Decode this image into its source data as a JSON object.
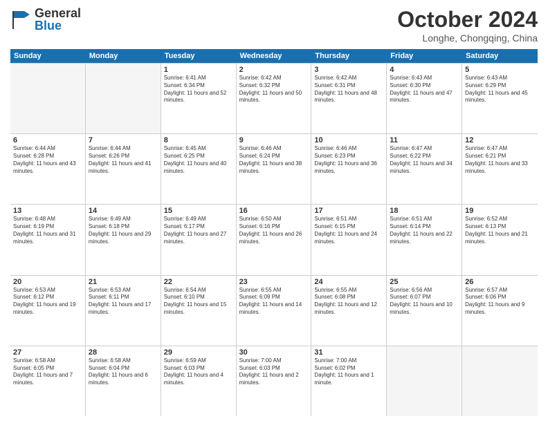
{
  "header": {
    "logo_general": "General",
    "logo_blue": "Blue",
    "month_title": "October 2024",
    "location": "Longhe, Chongqing, China"
  },
  "days_of_week": [
    "Sunday",
    "Monday",
    "Tuesday",
    "Wednesday",
    "Thursday",
    "Friday",
    "Saturday"
  ],
  "weeks": [
    [
      {
        "day": "",
        "info": "",
        "empty": true
      },
      {
        "day": "",
        "info": "",
        "empty": true
      },
      {
        "day": "1",
        "info": "Sunrise: 6:41 AM\nSunset: 6:34 PM\nDaylight: 11 hours and 52 minutes."
      },
      {
        "day": "2",
        "info": "Sunrise: 6:42 AM\nSunset: 6:32 PM\nDaylight: 11 hours and 50 minutes."
      },
      {
        "day": "3",
        "info": "Sunrise: 6:42 AM\nSunset: 6:31 PM\nDaylight: 11 hours and 48 minutes."
      },
      {
        "day": "4",
        "info": "Sunrise: 6:43 AM\nSunset: 6:30 PM\nDaylight: 11 hours and 47 minutes."
      },
      {
        "day": "5",
        "info": "Sunrise: 6:43 AM\nSunset: 6:29 PM\nDaylight: 11 hours and 45 minutes."
      }
    ],
    [
      {
        "day": "6",
        "info": "Sunrise: 6:44 AM\nSunset: 6:28 PM\nDaylight: 11 hours and 43 minutes."
      },
      {
        "day": "7",
        "info": "Sunrise: 6:44 AM\nSunset: 6:26 PM\nDaylight: 11 hours and 41 minutes."
      },
      {
        "day": "8",
        "info": "Sunrise: 6:45 AM\nSunset: 6:25 PM\nDaylight: 11 hours and 40 minutes."
      },
      {
        "day": "9",
        "info": "Sunrise: 6:46 AM\nSunset: 6:24 PM\nDaylight: 11 hours and 38 minutes."
      },
      {
        "day": "10",
        "info": "Sunrise: 6:46 AM\nSunset: 6:23 PM\nDaylight: 11 hours and 36 minutes."
      },
      {
        "day": "11",
        "info": "Sunrise: 6:47 AM\nSunset: 6:22 PM\nDaylight: 11 hours and 34 minutes."
      },
      {
        "day": "12",
        "info": "Sunrise: 6:47 AM\nSunset: 6:21 PM\nDaylight: 11 hours and 33 minutes."
      }
    ],
    [
      {
        "day": "13",
        "info": "Sunrise: 6:48 AM\nSunset: 6:19 PM\nDaylight: 11 hours and 31 minutes."
      },
      {
        "day": "14",
        "info": "Sunrise: 6:49 AM\nSunset: 6:18 PM\nDaylight: 11 hours and 29 minutes."
      },
      {
        "day": "15",
        "info": "Sunrise: 6:49 AM\nSunset: 6:17 PM\nDaylight: 11 hours and 27 minutes."
      },
      {
        "day": "16",
        "info": "Sunrise: 6:50 AM\nSunset: 6:16 PM\nDaylight: 11 hours and 26 minutes."
      },
      {
        "day": "17",
        "info": "Sunrise: 6:51 AM\nSunset: 6:15 PM\nDaylight: 11 hours and 24 minutes."
      },
      {
        "day": "18",
        "info": "Sunrise: 6:51 AM\nSunset: 6:14 PM\nDaylight: 11 hours and 22 minutes."
      },
      {
        "day": "19",
        "info": "Sunrise: 6:52 AM\nSunset: 6:13 PM\nDaylight: 11 hours and 21 minutes."
      }
    ],
    [
      {
        "day": "20",
        "info": "Sunrise: 6:53 AM\nSunset: 6:12 PM\nDaylight: 11 hours and 19 minutes."
      },
      {
        "day": "21",
        "info": "Sunrise: 6:53 AM\nSunset: 6:11 PM\nDaylight: 11 hours and 17 minutes."
      },
      {
        "day": "22",
        "info": "Sunrise: 6:54 AM\nSunset: 6:10 PM\nDaylight: 11 hours and 15 minutes."
      },
      {
        "day": "23",
        "info": "Sunrise: 6:55 AM\nSunset: 6:09 PM\nDaylight: 11 hours and 14 minutes."
      },
      {
        "day": "24",
        "info": "Sunrise: 6:55 AM\nSunset: 6:08 PM\nDaylight: 11 hours and 12 minutes."
      },
      {
        "day": "25",
        "info": "Sunrise: 6:56 AM\nSunset: 6:07 PM\nDaylight: 11 hours and 10 minutes."
      },
      {
        "day": "26",
        "info": "Sunrise: 6:57 AM\nSunset: 6:06 PM\nDaylight: 11 hours and 9 minutes."
      }
    ],
    [
      {
        "day": "27",
        "info": "Sunrise: 6:58 AM\nSunset: 6:05 PM\nDaylight: 11 hours and 7 minutes."
      },
      {
        "day": "28",
        "info": "Sunrise: 6:58 AM\nSunset: 6:04 PM\nDaylight: 11 hours and 6 minutes."
      },
      {
        "day": "29",
        "info": "Sunrise: 6:59 AM\nSunset: 6:03 PM\nDaylight: 11 hours and 4 minutes."
      },
      {
        "day": "30",
        "info": "Sunrise: 7:00 AM\nSunset: 6:03 PM\nDaylight: 11 hours and 2 minutes."
      },
      {
        "day": "31",
        "info": "Sunrise: 7:00 AM\nSunset: 6:02 PM\nDaylight: 11 hours and 1 minute."
      },
      {
        "day": "",
        "info": "",
        "empty": true
      },
      {
        "day": "",
        "info": "",
        "empty": true
      }
    ]
  ]
}
